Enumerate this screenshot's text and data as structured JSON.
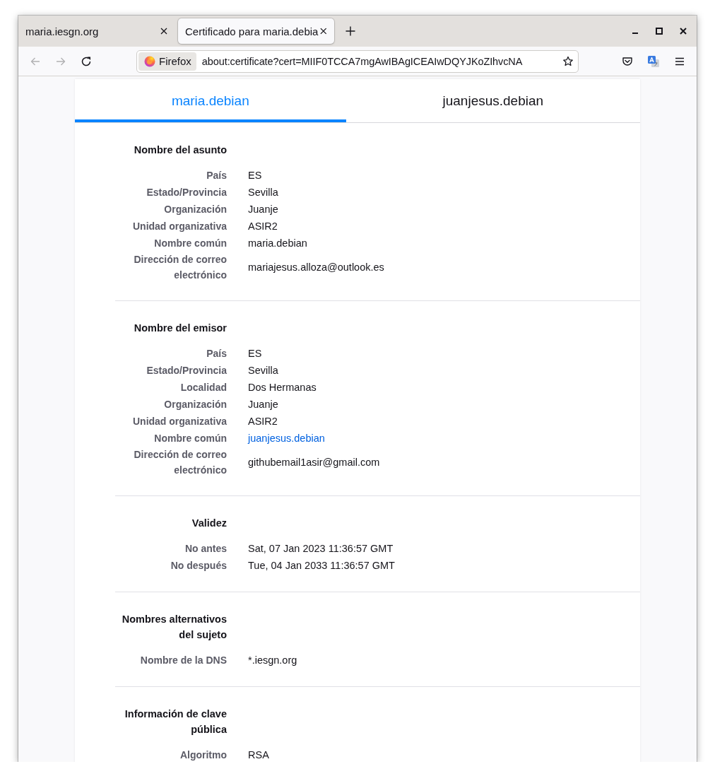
{
  "browser_tabs": [
    {
      "title": "maria.iesgn.org",
      "selected": false
    },
    {
      "title": "Certificado para maria.debia",
      "selected": true
    }
  ],
  "navigation": {
    "back": {
      "disabled": true
    },
    "forward": {
      "disabled": true
    },
    "identity": "Firefox",
    "url": "about:certificate?cert=MIIF0TCCA7mgAwIBAgICEAIwDQYJKoZIhvcNA"
  },
  "certificate_tabs": [
    {
      "label": "maria.debian",
      "selected": true
    },
    {
      "label": "juanjesus.debian",
      "selected": false
    }
  ],
  "sections": [
    {
      "title": "Nombre del asunto",
      "rows": [
        {
          "label": "País",
          "value": "ES",
          "kind": "text"
        },
        {
          "label": "Estado/Provincia",
          "value": "Sevilla",
          "kind": "text"
        },
        {
          "label": "Organización",
          "value": "Juanje",
          "kind": "text"
        },
        {
          "label": "Unidad organizativa",
          "value": "ASIR2",
          "kind": "text"
        },
        {
          "label": "Nombre común",
          "value": "maria.debian",
          "kind": "text"
        },
        {
          "label": "Dirección de correo electrónico",
          "value": "mariajesus.alloza@outlook.es",
          "kind": "text"
        }
      ]
    },
    {
      "title": "Nombre del emisor",
      "rows": [
        {
          "label": "País",
          "value": "ES",
          "kind": "text"
        },
        {
          "label": "Estado/Provincia",
          "value": "Sevilla",
          "kind": "text"
        },
        {
          "label": "Localidad",
          "value": "Dos Hermanas",
          "kind": "text"
        },
        {
          "label": "Organización",
          "value": "Juanje",
          "kind": "text"
        },
        {
          "label": "Unidad organizativa",
          "value": "ASIR2",
          "kind": "text"
        },
        {
          "label": "Nombre común",
          "value": "juanjesus.debian",
          "kind": "link"
        },
        {
          "label": "Dirección de correo electrónico",
          "value": "githubemail1asir@gmail.com",
          "kind": "text"
        }
      ]
    },
    {
      "title": "Validez",
      "rows": [
        {
          "label": "No antes",
          "value": "Sat, 07 Jan 2023 11:36:57 GMT",
          "kind": "text"
        },
        {
          "label": "No después",
          "value": "Tue, 04 Jan 2033 11:36:57 GMT",
          "kind": "text"
        }
      ]
    },
    {
      "title": "Nombres alternativos del sujeto",
      "rows": [
        {
          "label": "Nombre de la DNS",
          "value": "*.iesgn.org",
          "kind": "text"
        }
      ]
    },
    {
      "title": "Información de clave pública",
      "rows": [
        {
          "label": "Algoritmo",
          "value": "RSA",
          "kind": "text"
        }
      ]
    }
  ]
}
